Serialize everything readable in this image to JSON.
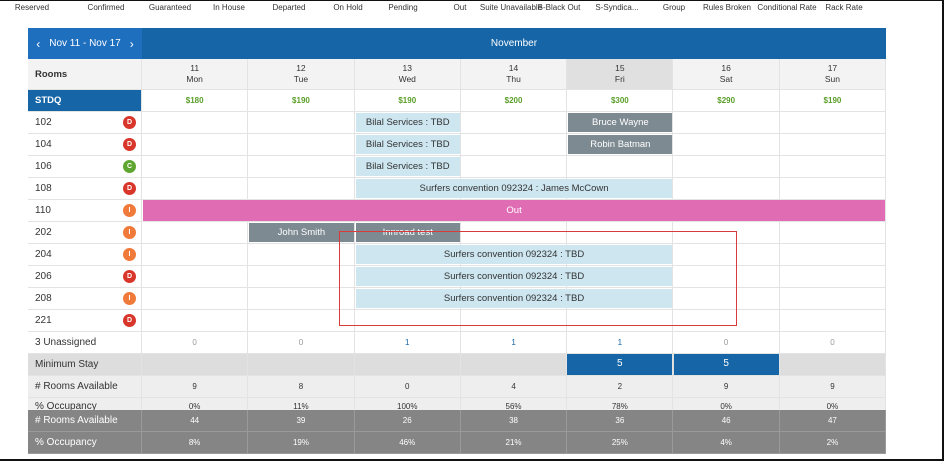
{
  "legend": [
    "Reserved",
    "Confirmed",
    "Guaranteed",
    "In House",
    "Departed",
    "On Hold",
    "Pending",
    "Out",
    "Suite Unavailable",
    "B-Black Out",
    "S-Syndica...",
    "Group",
    "Rules Broken",
    "Conditional Rate",
    "Rack Rate"
  ],
  "nav": {
    "prev_icon": "‹",
    "range": "Nov 11 - Nov 17",
    "next_icon": "›",
    "month": "November"
  },
  "rooms_header": "Rooms",
  "days": [
    {
      "num": "11",
      "dow": "Mon",
      "rate": "$180"
    },
    {
      "num": "12",
      "dow": "Tue",
      "rate": "$190"
    },
    {
      "num": "13",
      "dow": "Wed",
      "rate": "$190"
    },
    {
      "num": "14",
      "dow": "Thu",
      "rate": "$200"
    },
    {
      "num": "15",
      "dow": "Fri",
      "rate": "$300"
    },
    {
      "num": "16",
      "dow": "Sat",
      "rate": "$290"
    },
    {
      "num": "17",
      "dow": "Sun",
      "rate": "$190"
    }
  ],
  "room_type": "STDQ",
  "rooms": [
    {
      "number": "102",
      "status": "D",
      "color": "#d9362b"
    },
    {
      "number": "104",
      "status": "D",
      "color": "#d9362b"
    },
    {
      "number": "106",
      "status": "C",
      "color": "#5fa631"
    },
    {
      "number": "108",
      "status": "D",
      "color": "#d9362b"
    },
    {
      "number": "110",
      "status": "I",
      "color": "#f07a3a"
    },
    {
      "number": "202",
      "status": "I",
      "color": "#f07a3a"
    },
    {
      "number": "204",
      "status": "I",
      "color": "#f07a3a"
    },
    {
      "number": "206",
      "status": "D",
      "color": "#d9362b"
    },
    {
      "number": "208",
      "status": "I",
      "color": "#f07a3a"
    },
    {
      "number": "221",
      "status": "D",
      "color": "#d9362b"
    }
  ],
  "reservations": [
    {
      "room": 0,
      "start": 2,
      "span": 1,
      "label": "Bilal Services : TBD",
      "style": "light"
    },
    {
      "room": 0,
      "start": 4,
      "span": 1,
      "label": "Bruce Wayne",
      "style": "grey"
    },
    {
      "room": 1,
      "start": 2,
      "span": 1,
      "label": "Bilal Services : TBD",
      "style": "light"
    },
    {
      "room": 1,
      "start": 4,
      "span": 1,
      "label": "Robin Batman",
      "style": "grey"
    },
    {
      "room": 2,
      "start": 2,
      "span": 1,
      "label": "Bilal Services : TBD",
      "style": "light"
    },
    {
      "room": 3,
      "start": 2,
      "span": 3,
      "label": "Surfers convention 092324 : James McCown",
      "style": "light"
    },
    {
      "room": 4,
      "start": 0,
      "span": 7,
      "label": "Out",
      "style": "pink"
    },
    {
      "room": 5,
      "start": 1,
      "span": 1,
      "label": "John Smith",
      "style": "grey"
    },
    {
      "room": 5,
      "start": 2,
      "span": 1,
      "label": "Innroad test",
      "style": "grey"
    },
    {
      "room": 6,
      "start": 2,
      "span": 3,
      "label": "Surfers convention 092324 : TBD",
      "style": "light"
    },
    {
      "room": 7,
      "start": 2,
      "span": 3,
      "label": "Surfers convention 092324 : TBD",
      "style": "light"
    },
    {
      "room": 8,
      "start": 2,
      "span": 3,
      "label": "Surfers convention 092324 : TBD",
      "style": "light"
    }
  ],
  "unassigned": {
    "label": "3 Unassigned",
    "values": [
      "0",
      "0",
      "1",
      "1",
      "1",
      "0",
      "0"
    ]
  },
  "minimum_stay": {
    "label": "Minimum Stay",
    "values": [
      "",
      "",
      "",
      "",
      "5",
      "5",
      ""
    ]
  },
  "rooms_available": {
    "label": "# Rooms Available",
    "values": [
      "9",
      "8",
      "0",
      "4",
      "2",
      "9",
      "9"
    ]
  },
  "occupancy": {
    "label": "% Occupancy",
    "values": [
      "0%",
      "11%",
      "100%",
      "56%",
      "78%",
      "0%",
      "0%"
    ]
  },
  "totals_available": {
    "label": "# Rooms Available",
    "values": [
      "44",
      "39",
      "26",
      "38",
      "36",
      "46",
      "47"
    ]
  },
  "totals_occupancy": {
    "label": "% Occupancy",
    "values": [
      "8%",
      "19%",
      "46%",
      "21%",
      "25%",
      "4%",
      "2%"
    ]
  }
}
